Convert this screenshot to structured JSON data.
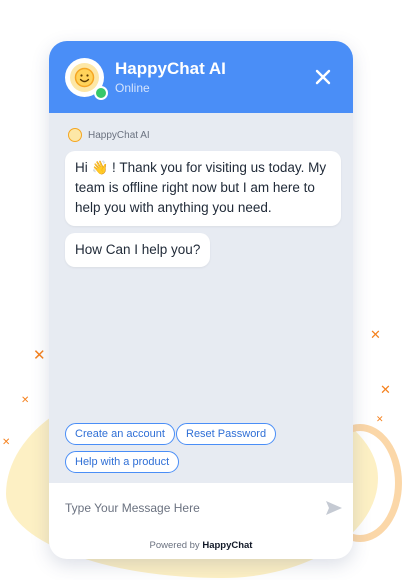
{
  "header": {
    "title": "HappyChat AI",
    "status": "Online"
  },
  "chat": {
    "sender_name": "HappyChat AI",
    "messages": [
      {
        "text": "Hi 👋 ! Thank you for visiting us today. My team is offline right now but I am here to help you with anything you need."
      },
      {
        "text": "How Can I help you?"
      }
    ]
  },
  "quick_replies": [
    {
      "label": "Create an account"
    },
    {
      "label": "Reset Password"
    },
    {
      "label": "Help with a product"
    }
  ],
  "composer": {
    "placeholder": "Type Your Message Here"
  },
  "footer": {
    "prefix": "Powered by",
    "brand": "HappyChat"
  },
  "colors": {
    "header": "#4a8ef7",
    "online": "#37c76a",
    "accent": "#f5821f"
  }
}
